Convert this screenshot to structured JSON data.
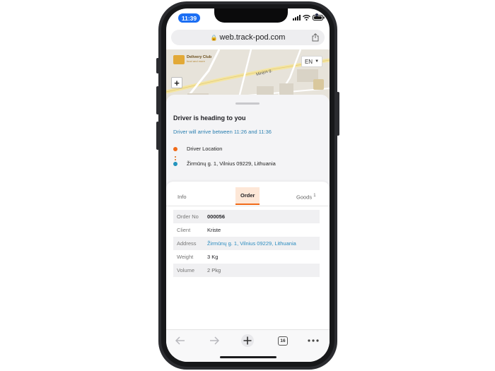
{
  "status_bar": {
    "time": "11:39"
  },
  "browser": {
    "url": "web.track-pod.com",
    "tab_count": "16"
  },
  "map": {
    "brand_name": "Delivery Club",
    "brand_tagline": "food and more",
    "language": "EN",
    "zoom_in": "+",
    "street_name": "Minijos g."
  },
  "tracking": {
    "title": "Driver is heading to you",
    "eta": "Driver will arrive between 11:26 and 11:36",
    "driver_location": "Driver Location",
    "destination": "Žirmūnų g. 1, Vilnius 09229, Lithuania"
  },
  "tabs": [
    {
      "label": "Info"
    },
    {
      "label": "Order"
    },
    {
      "label": "Goods",
      "badge": "1"
    }
  ],
  "order": [
    {
      "key": "Order No",
      "value": "000056"
    },
    {
      "key": "Client",
      "value": "Kriste"
    },
    {
      "key": "Address",
      "value": "Žirmūnų g. 1, Vilnius 09229, Lithuania"
    },
    {
      "key": "Weight",
      "value": "3 Kg"
    },
    {
      "key": "Volume",
      "value": "2 Pkg"
    }
  ],
  "colors": {
    "accent": "#f06a18",
    "link": "#2a8bbf",
    "time_pill": "#1b6ef3",
    "brand": "#e2a937"
  },
  "icons": [
    "lock-icon",
    "share-icon",
    "back-icon",
    "forward-icon",
    "new-tab-icon",
    "tabs-icon",
    "more-icon",
    "signal-icon",
    "wifi-icon",
    "battery-icon"
  ]
}
